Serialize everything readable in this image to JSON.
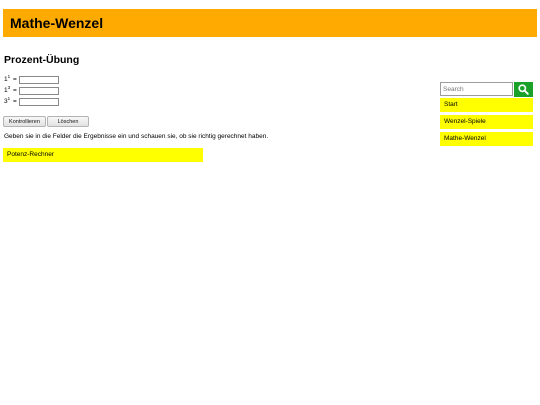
{
  "header": {
    "title": "Mathe-Wenzel"
  },
  "page": {
    "title": "Prozent-Übung"
  },
  "exercises": [
    {
      "base": "1",
      "exponent": "1",
      "equals": "=",
      "value": ""
    },
    {
      "base": "1",
      "exponent": "3",
      "equals": "=",
      "value": ""
    },
    {
      "base": "3",
      "exponent": "1",
      "equals": "=",
      "value": ""
    }
  ],
  "buttons": {
    "check": "Kontrollieren",
    "clear": "Löschen"
  },
  "instructions": "Geben sie in die Felder die Ergebnisse ein und schauen sie, ob sie richtig gerechnet haben.",
  "links": {
    "potenz": "Potenz-Rechner"
  },
  "sidebar": {
    "search": {
      "placeholder": "Search",
      "icon": "search-icon"
    },
    "items": [
      {
        "label": "Start"
      },
      {
        "label": "Wenzel-Spiele"
      },
      {
        "label": "Mathe-Wenzel"
      }
    ]
  },
  "colors": {
    "header": "#ffaa00",
    "highlight": "#ffff00",
    "search_button": "#19a12a"
  }
}
